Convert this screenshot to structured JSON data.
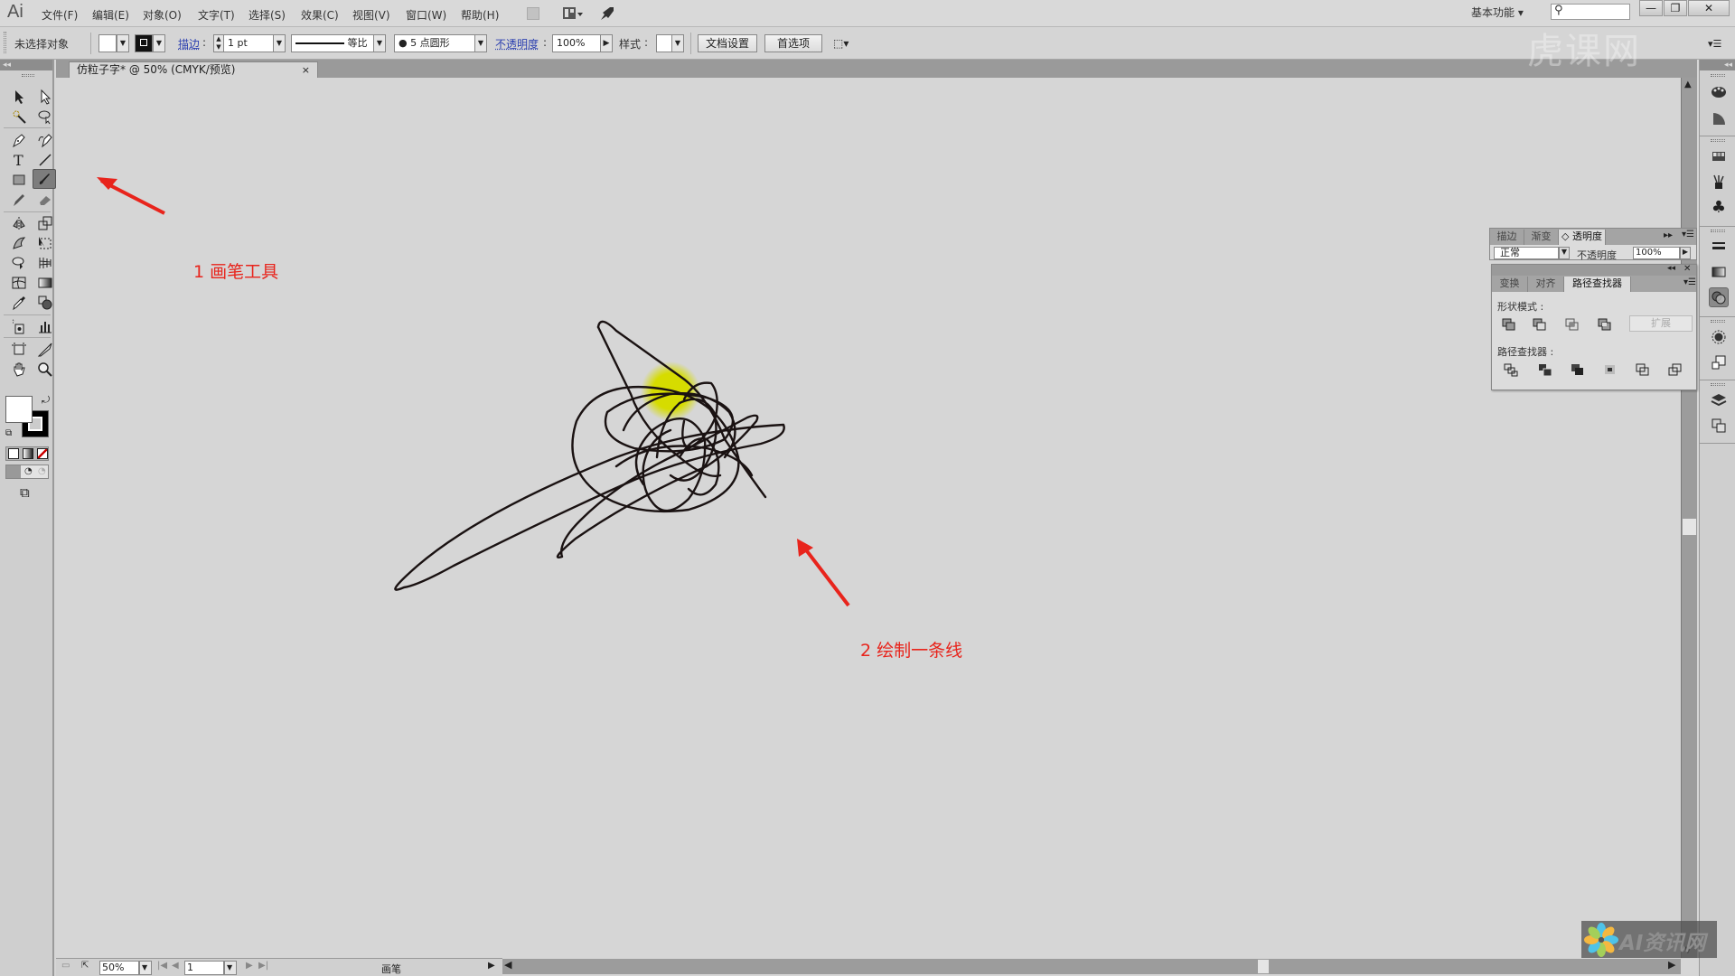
{
  "app": {
    "logo": "Ai"
  },
  "menubar": {
    "items": [
      "文件(F)",
      "编辑(E)",
      "对象(O)",
      "文字(T)",
      "选择(S)",
      "效果(C)",
      "视图(V)",
      "窗口(W)",
      "帮助(H)"
    ],
    "workspace": "基本功能",
    "search_placeholder": "",
    "window_controls": {
      "minimize": "—",
      "restore": "❐",
      "close": "✕"
    }
  },
  "controlbar": {
    "selection_status": "未选择对象",
    "stroke_label": "描边",
    "stroke_weight": "1 pt",
    "stroke_profile": "等比",
    "brush_def": "5 点圆形",
    "opacity_label": "不透明度",
    "opacity_value": "100%",
    "style_label": "样式",
    "doc_setup_button": "文档设置",
    "preferences_button": "首选项"
  },
  "document": {
    "tab_title": "仿粒子字* @ 50% (CMYK/预览)",
    "close_glyph": "×"
  },
  "toolbox": {
    "collapse": "◂◂",
    "active_tool": "paintbrush-tool",
    "fill_color": "#ffffff",
    "stroke_color": "#000000"
  },
  "statusbar": {
    "zoom": "50%",
    "artboard": "1",
    "current_tool": "画笔"
  },
  "panels": {
    "transparency": {
      "tabs": [
        "描边",
        "渐变",
        "◇ 透明度"
      ],
      "blend_mode": "正常",
      "opacity_label": "不透明度",
      "opacity_value": "100%"
    },
    "pathfinder": {
      "tabs": [
        "变换",
        "对齐",
        "路径查找器"
      ],
      "shape_modes_label": "形状模式 :",
      "expand_button": "扩展",
      "pathfinders_label": "路径查找器 :"
    }
  },
  "annotations": [
    {
      "text": "1 画笔工具",
      "color": "#e8241c"
    },
    {
      "text": "2 绘制一条线",
      "color": "#e8241c"
    }
  ],
  "canvas": {
    "highlight_color": "#d6dc00",
    "stroke_color": "#1a1212"
  },
  "watermark": {
    "text": "AI资讯网"
  },
  "overlay_watermark": {
    "text": "虎课网"
  }
}
